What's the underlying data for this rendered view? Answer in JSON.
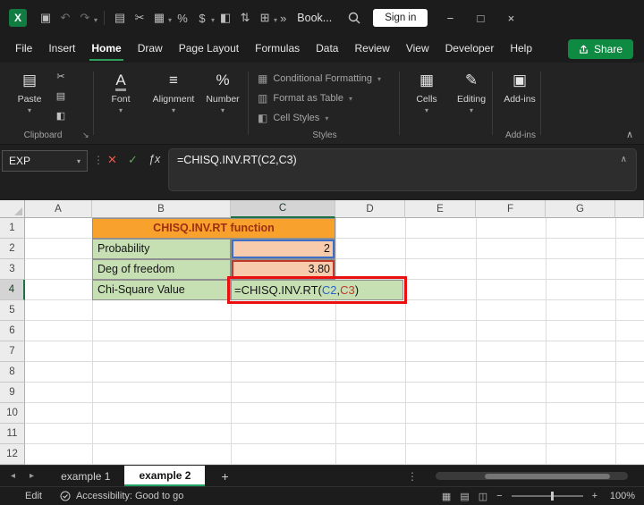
{
  "window": {
    "app_logo": "X",
    "workbook_name": "Book...",
    "sign_in_label": "Sign in"
  },
  "icons": {
    "caret": "▾",
    "save": "▣",
    "undo": "↶",
    "redo": "↷",
    "paste": "▤",
    "cut": "✂",
    "picture": "▦",
    "percent": "%",
    "currency": "$",
    "fill_color": "◧",
    "sort": "⇅",
    "table": "⊞",
    "overflow": "»",
    "minimize": "−",
    "maximize": "□",
    "close": "×",
    "cancel": "✕",
    "confirm": "✓",
    "fx": "ƒx",
    "collapse_ribbon": "∧",
    "expand_formula_bar": "∧",
    "drag_dots": "⋮",
    "more_dots": "⋮",
    "nav_left": "◂",
    "nav_right": "▸",
    "add_sheet": "+",
    "view_normal": "▦",
    "view_layout": "▤",
    "view_break": "◫",
    "zoom_out": "−",
    "zoom_in": "+",
    "dialog_launcher": "↘",
    "font_button": "A",
    "alignment_button": "≡",
    "number_button": "%",
    "cf_icon": "▦",
    "fat_icon": "▥",
    "cs_icon": "◧",
    "cells_icon": "▦",
    "editing_icon": "✎",
    "addins_icon": "▣",
    "copy_small": "▤",
    "cut_small": "✂",
    "painter_small": "◧"
  },
  "menu": {
    "items": [
      "File",
      "Insert",
      "Home",
      "Draw",
      "Page Layout",
      "Formulas",
      "Data",
      "Review",
      "View",
      "Developer",
      "Help"
    ],
    "share_label": "Share"
  },
  "ribbon": {
    "paste_label": "Paste",
    "clipboard_group": "Clipboard",
    "font_label": "Font",
    "alignment_label": "Alignment",
    "number_label": "Number",
    "conditional_formatting_label": "Conditional Formatting",
    "format_as_table_label": "Format as Table",
    "cell_styles_label": "Cell Styles",
    "styles_group": "Styles",
    "cells_label": "Cells",
    "editing_label": "Editing",
    "addins_label": "Add-ins",
    "addins_group": "Add-ins"
  },
  "formula_bar": {
    "name_box_value": "EXP",
    "formula": "=CHISQ.INV.RT(C2,C3)"
  },
  "grid": {
    "columns": [
      "A",
      "B",
      "C",
      "D",
      "E",
      "F",
      "G"
    ],
    "rows": [
      "1",
      "2",
      "3",
      "4",
      "5",
      "6",
      "7",
      "8",
      "9",
      "10",
      "11",
      "12"
    ],
    "cells": {
      "title": "CHISQ.INV.RT function",
      "probability_label": "Probability",
      "probability_value": "2",
      "dof_label": "Deg of freedom",
      "dof_value": "3.80",
      "result_label": "Chi-Square Value",
      "formula_prefix": "=CHISQ.INV.RT(",
      "formula_ref1": "C2",
      "formula_sep": ",",
      "formula_ref2": "C3",
      "formula_suffix": ")"
    }
  },
  "sheet_tabs": {
    "tabs": [
      "example 1",
      "example 2"
    ],
    "active": "example 2"
  },
  "status_bar": {
    "mode": "Edit",
    "accessibility": "Accessibility: Good to go",
    "zoom_level": "100%"
  },
  "colors": {
    "accent_green": "#107C41",
    "title_fill": "#F8A12D",
    "title_text": "#9E2F14",
    "label_fill": "#C6E0B4",
    "value_fill": "#F8CBAD",
    "ref1": "#2B62C9",
    "ref2": "#C0392B",
    "annotation": "#EA1010"
  }
}
